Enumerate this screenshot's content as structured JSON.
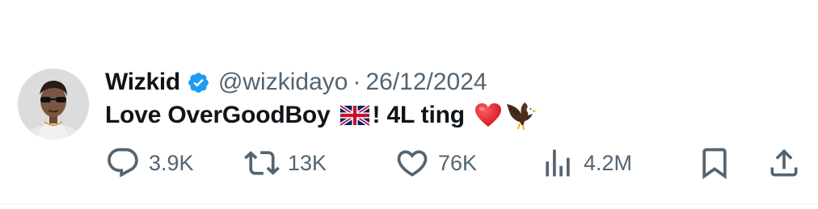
{
  "tweet": {
    "author": {
      "name": "Wizkid",
      "handle": "@wizkidayo",
      "verified": true,
      "verified_color": "#1d9bf0"
    },
    "separator": "·",
    "date": "26/12/2024",
    "text_parts": {
      "main": "Love OverGoodBoy",
      "emoji_flag": "uk-flag-emoji",
      "after_flag": "! 4L ting",
      "emoji_heart": "red-heart-emoji",
      "emoji_eagle": "eagle-emoji"
    }
  },
  "actions": {
    "reply": {
      "icon": "reply-icon",
      "count": "3.9K"
    },
    "repost": {
      "icon": "repost-icon",
      "count": "13K"
    },
    "like": {
      "icon": "heart-icon",
      "count": "76K"
    },
    "views": {
      "icon": "views-icon",
      "count": "4.2M"
    },
    "bookmark": {
      "icon": "bookmark-icon"
    },
    "share": {
      "icon": "share-icon"
    }
  },
  "colors": {
    "text": "#0f1419",
    "secondary": "#536471",
    "accent": "#1d9bf0",
    "heart": "#e0202a"
  }
}
